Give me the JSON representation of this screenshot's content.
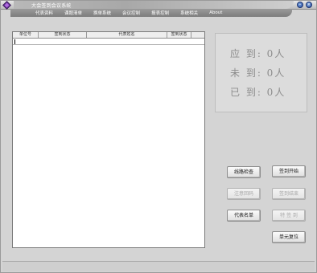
{
  "window": {
    "title": "大会签到会议系统"
  },
  "menu": {
    "items": [
      "代表资料",
      "课题清单",
      "换单系统",
      "会议控制",
      "报表控制",
      "系统相关",
      "About"
    ]
  },
  "list": {
    "columns": [
      "单位号",
      "签到状态",
      "代表姓名",
      "签到状态"
    ]
  },
  "stats": {
    "should_arrive": "应  到: 0人",
    "not_arrived": "未  到: 0人",
    "arrived": "已  到: 0人"
  },
  "buttons": {
    "connection_check": "线路检查",
    "start_checkin": "签到开始",
    "rollback_code": "注意回码",
    "end_checkin": "签到结束",
    "delegate_list": "代表名单",
    "special_checkin": "特 签 到",
    "reset_unit": "单元复位"
  },
  "colors": {
    "window_bg": "#d4d4d4",
    "titlebar_band": "#a8a8a8",
    "menubar": "#8a8a8a",
    "stats_text": "#8c8c8c"
  }
}
